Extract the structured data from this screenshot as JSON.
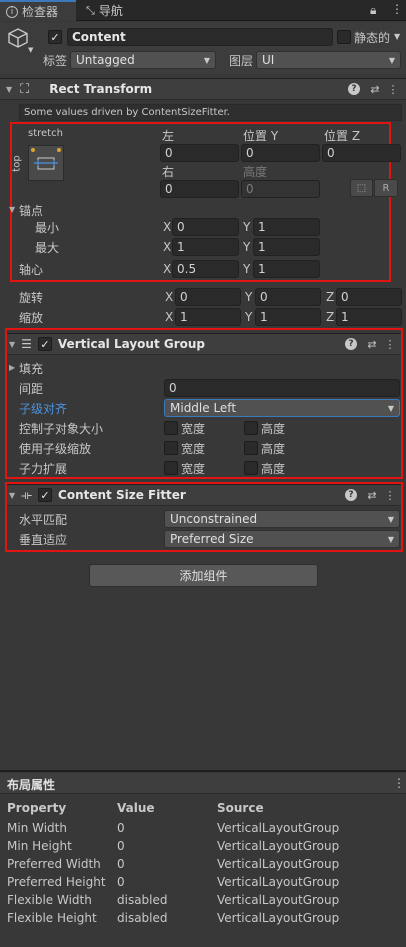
{
  "tabs": [
    {
      "label": "检查器",
      "icon": "info-icon"
    },
    {
      "label": "导航",
      "icon": "navigation-icon"
    }
  ],
  "tab_actions": {
    "lock_icon": "lock-icon",
    "menu_icon": "more-icon"
  },
  "gameobject": {
    "name": "Content",
    "static_label": "静态的",
    "tag_label": "标签",
    "tag_value": "Untagged",
    "layer_label": "图层",
    "layer_value": "UI"
  },
  "rect_transform": {
    "title": "Rect Transform",
    "info": "Some values driven by ContentSizeFitter.",
    "anchor_preset_h": "stretch",
    "anchor_preset_v": "top",
    "col_left": "左",
    "col_pos_y": "位置 Y",
    "col_pos_z": "位置 Z",
    "left": "0",
    "pos_y": "0",
    "pos_z": "0",
    "col_right": "右",
    "col_height": "高度",
    "right": "0",
    "height": "0",
    "raw_button": "R",
    "anchors_label": "锚点",
    "min_label": "最小",
    "max_label": "最大",
    "min_x": "0",
    "min_y": "1",
    "max_x": "1",
    "max_y": "1",
    "pivot_label": "轴心",
    "pivot_x": "0.5",
    "pivot_y": "1",
    "rotation_label": "旋转",
    "rot_x": "0",
    "rot_y": "0",
    "rot_z": "0",
    "scale_label": "缩放",
    "scale_x": "1",
    "scale_y": "1",
    "scale_z": "1",
    "x": "X",
    "y": "Y",
    "z": "Z"
  },
  "vertical_layout_group": {
    "title": "Vertical Layout Group",
    "padding_label": "填充",
    "spacing_label": "间距",
    "spacing_value": "0",
    "child_alignment_label": "子级对齐",
    "child_alignment_value": "Middle Left",
    "control_child_size_label": "控制子对象大小",
    "use_child_scale_label": "使用子级缩放",
    "child_force_expand_label": "子力扩展",
    "width_label": "宽度",
    "height_label": "高度"
  },
  "content_size_fitter": {
    "title": "Content Size Fitter",
    "horizontal_fit_label": "水平匹配",
    "horizontal_fit_value": "Unconstrained",
    "vertical_fit_label": "垂直适应",
    "vertical_fit_value": "Preferred Size"
  },
  "add_component_label": "添加组件",
  "layout_properties": {
    "title": "布局属性",
    "headers": [
      "Property",
      "Value",
      "Source"
    ],
    "rows": [
      [
        "Min Width",
        "0",
        "VerticalLayoutGroup"
      ],
      [
        "Min Height",
        "0",
        "VerticalLayoutGroup"
      ],
      [
        "Preferred Width",
        "0",
        "VerticalLayoutGroup"
      ],
      [
        "Preferred Height",
        "0",
        "VerticalLayoutGroup"
      ],
      [
        "Flexible Width",
        "disabled",
        "VerticalLayoutGroup"
      ],
      [
        "Flexible Height",
        "disabled",
        "VerticalLayoutGroup"
      ]
    ]
  },
  "colors": {
    "accent": "#3a79bb",
    "highlight_box": "#e1140f",
    "link_blue": "#4c92e0"
  }
}
